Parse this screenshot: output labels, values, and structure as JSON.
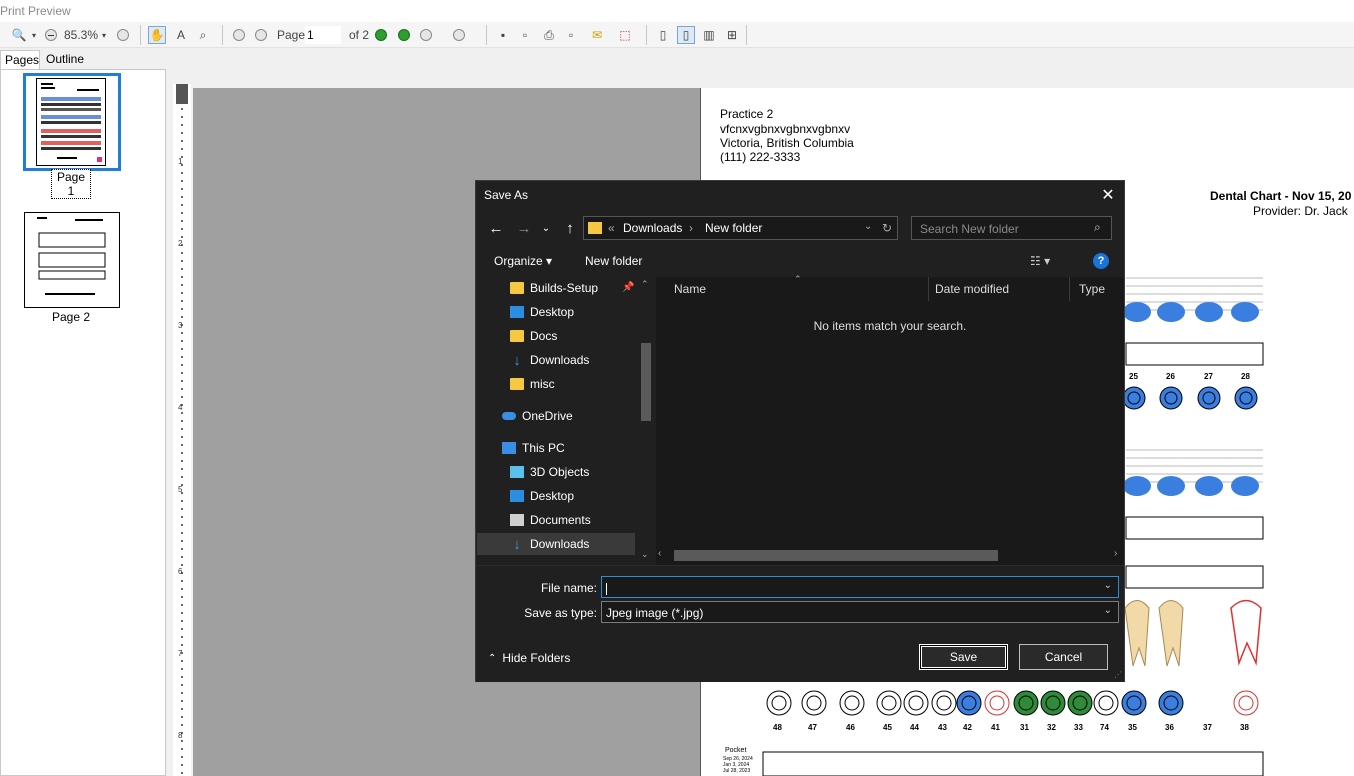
{
  "window": {
    "title": "Print Preview"
  },
  "toolbar": {
    "zoom": "85.3%",
    "page_label": "Page",
    "page_value": "1",
    "of_label": "of 2"
  },
  "side_tabs": [
    "Pages",
    "Outline"
  ],
  "thumbnails": [
    "Page 1",
    "Page 2"
  ],
  "ruler_marks": [
    "1",
    "2",
    "3",
    "4",
    "5",
    "6",
    "7",
    "8"
  ],
  "document": {
    "practice": "Practice 2",
    "address1": "vfcnxvgbnxvgbnxvgbnxv",
    "city": "Victoria, British Columbia",
    "phone": "(111) 222-3333",
    "chart_title": "Dental Chart - Nov 15, 20",
    "provider": "Provider: Dr. Jack",
    "upper_numbers": [
      "25",
      "26",
      "27",
      "28"
    ],
    "lower_numbers": [
      "48",
      "47",
      "46",
      "45",
      "44",
      "43",
      "42",
      "41",
      "31",
      "32",
      "33",
      "74",
      "35",
      "36",
      "37",
      "38"
    ],
    "pocket_label": "Pocket",
    "pocket_dates": [
      "Sep 26, 2024",
      "Jan 3, 2024",
      "Jul 28, 2023"
    ]
  },
  "dialog": {
    "title": "Save As",
    "breadcrumb": [
      "Downloads",
      "New folder"
    ],
    "search_placeholder": "Search New folder",
    "organize": "Organize",
    "new_folder": "New folder",
    "nav_items": [
      {
        "label": "Builds-Setup",
        "icon": "folder-icon"
      },
      {
        "label": "Desktop",
        "icon": "desktop-icon"
      },
      {
        "label": "Docs",
        "icon": "folder-icon"
      },
      {
        "label": "Downloads",
        "icon": "download-icon"
      },
      {
        "label": "misc",
        "icon": "folder-icon"
      },
      {
        "label": "OneDrive",
        "icon": "cloud-icon"
      },
      {
        "label": "This PC",
        "icon": "computer-icon"
      },
      {
        "label": "3D Objects",
        "icon": "cube-icon"
      },
      {
        "label": "Desktop",
        "icon": "desktop-icon"
      },
      {
        "label": "Documents",
        "icon": "document-icon"
      },
      {
        "label": "Downloads",
        "icon": "download-icon"
      }
    ],
    "columns": [
      "Name",
      "Date modified",
      "Type"
    ],
    "empty_message": "No items match your search.",
    "file_name_label": "File name:",
    "file_name_value": "",
    "save_type_label": "Save as type:",
    "save_type_value": "Jpeg image (*.jpg)",
    "save_button": "Save",
    "cancel_button": "Cancel",
    "hide_folders": "Hide Folders"
  },
  "colors": {
    "accent": "#1e7fd6",
    "dialog_bg": "#202020",
    "tooth_blue": "#3a7fe0",
    "tooth_green": "#2e8b3a",
    "tooth_red": "#e03030"
  }
}
